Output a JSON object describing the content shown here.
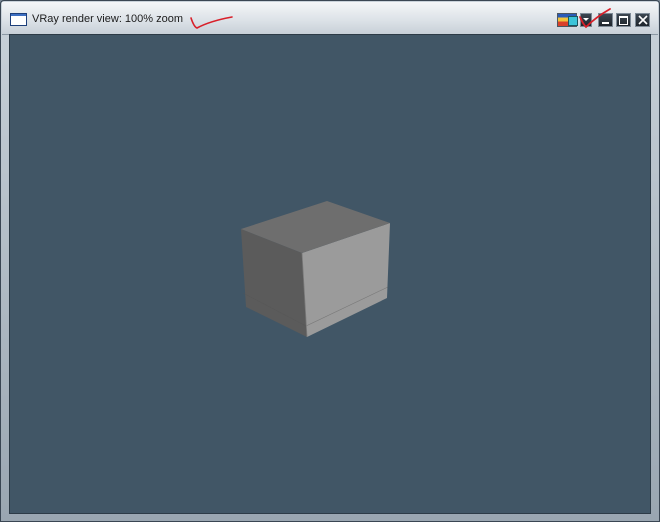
{
  "window": {
    "title": "VRay render view: 100% zoom",
    "icon": "window-icon"
  },
  "titlebar_buttons": [
    {
      "name": "color-channels-button",
      "icon": "rgb-channels-icon"
    },
    {
      "name": "dropdown-button",
      "icon": "chevron-down-icon"
    },
    {
      "name": "minimize-button",
      "icon": "minimize-icon"
    },
    {
      "name": "maximize-button",
      "icon": "maximize-icon"
    },
    {
      "name": "close-button",
      "icon": "close-icon"
    }
  ],
  "colors": {
    "render_background": "#415666",
    "cube_top": "#6d6d6d",
    "cube_left": "#5a5a5a",
    "cube_right": "#9a9a9a",
    "annotation_ink": "#d8202a"
  },
  "render": {
    "scene": "single gray cube on blue-gray background"
  }
}
